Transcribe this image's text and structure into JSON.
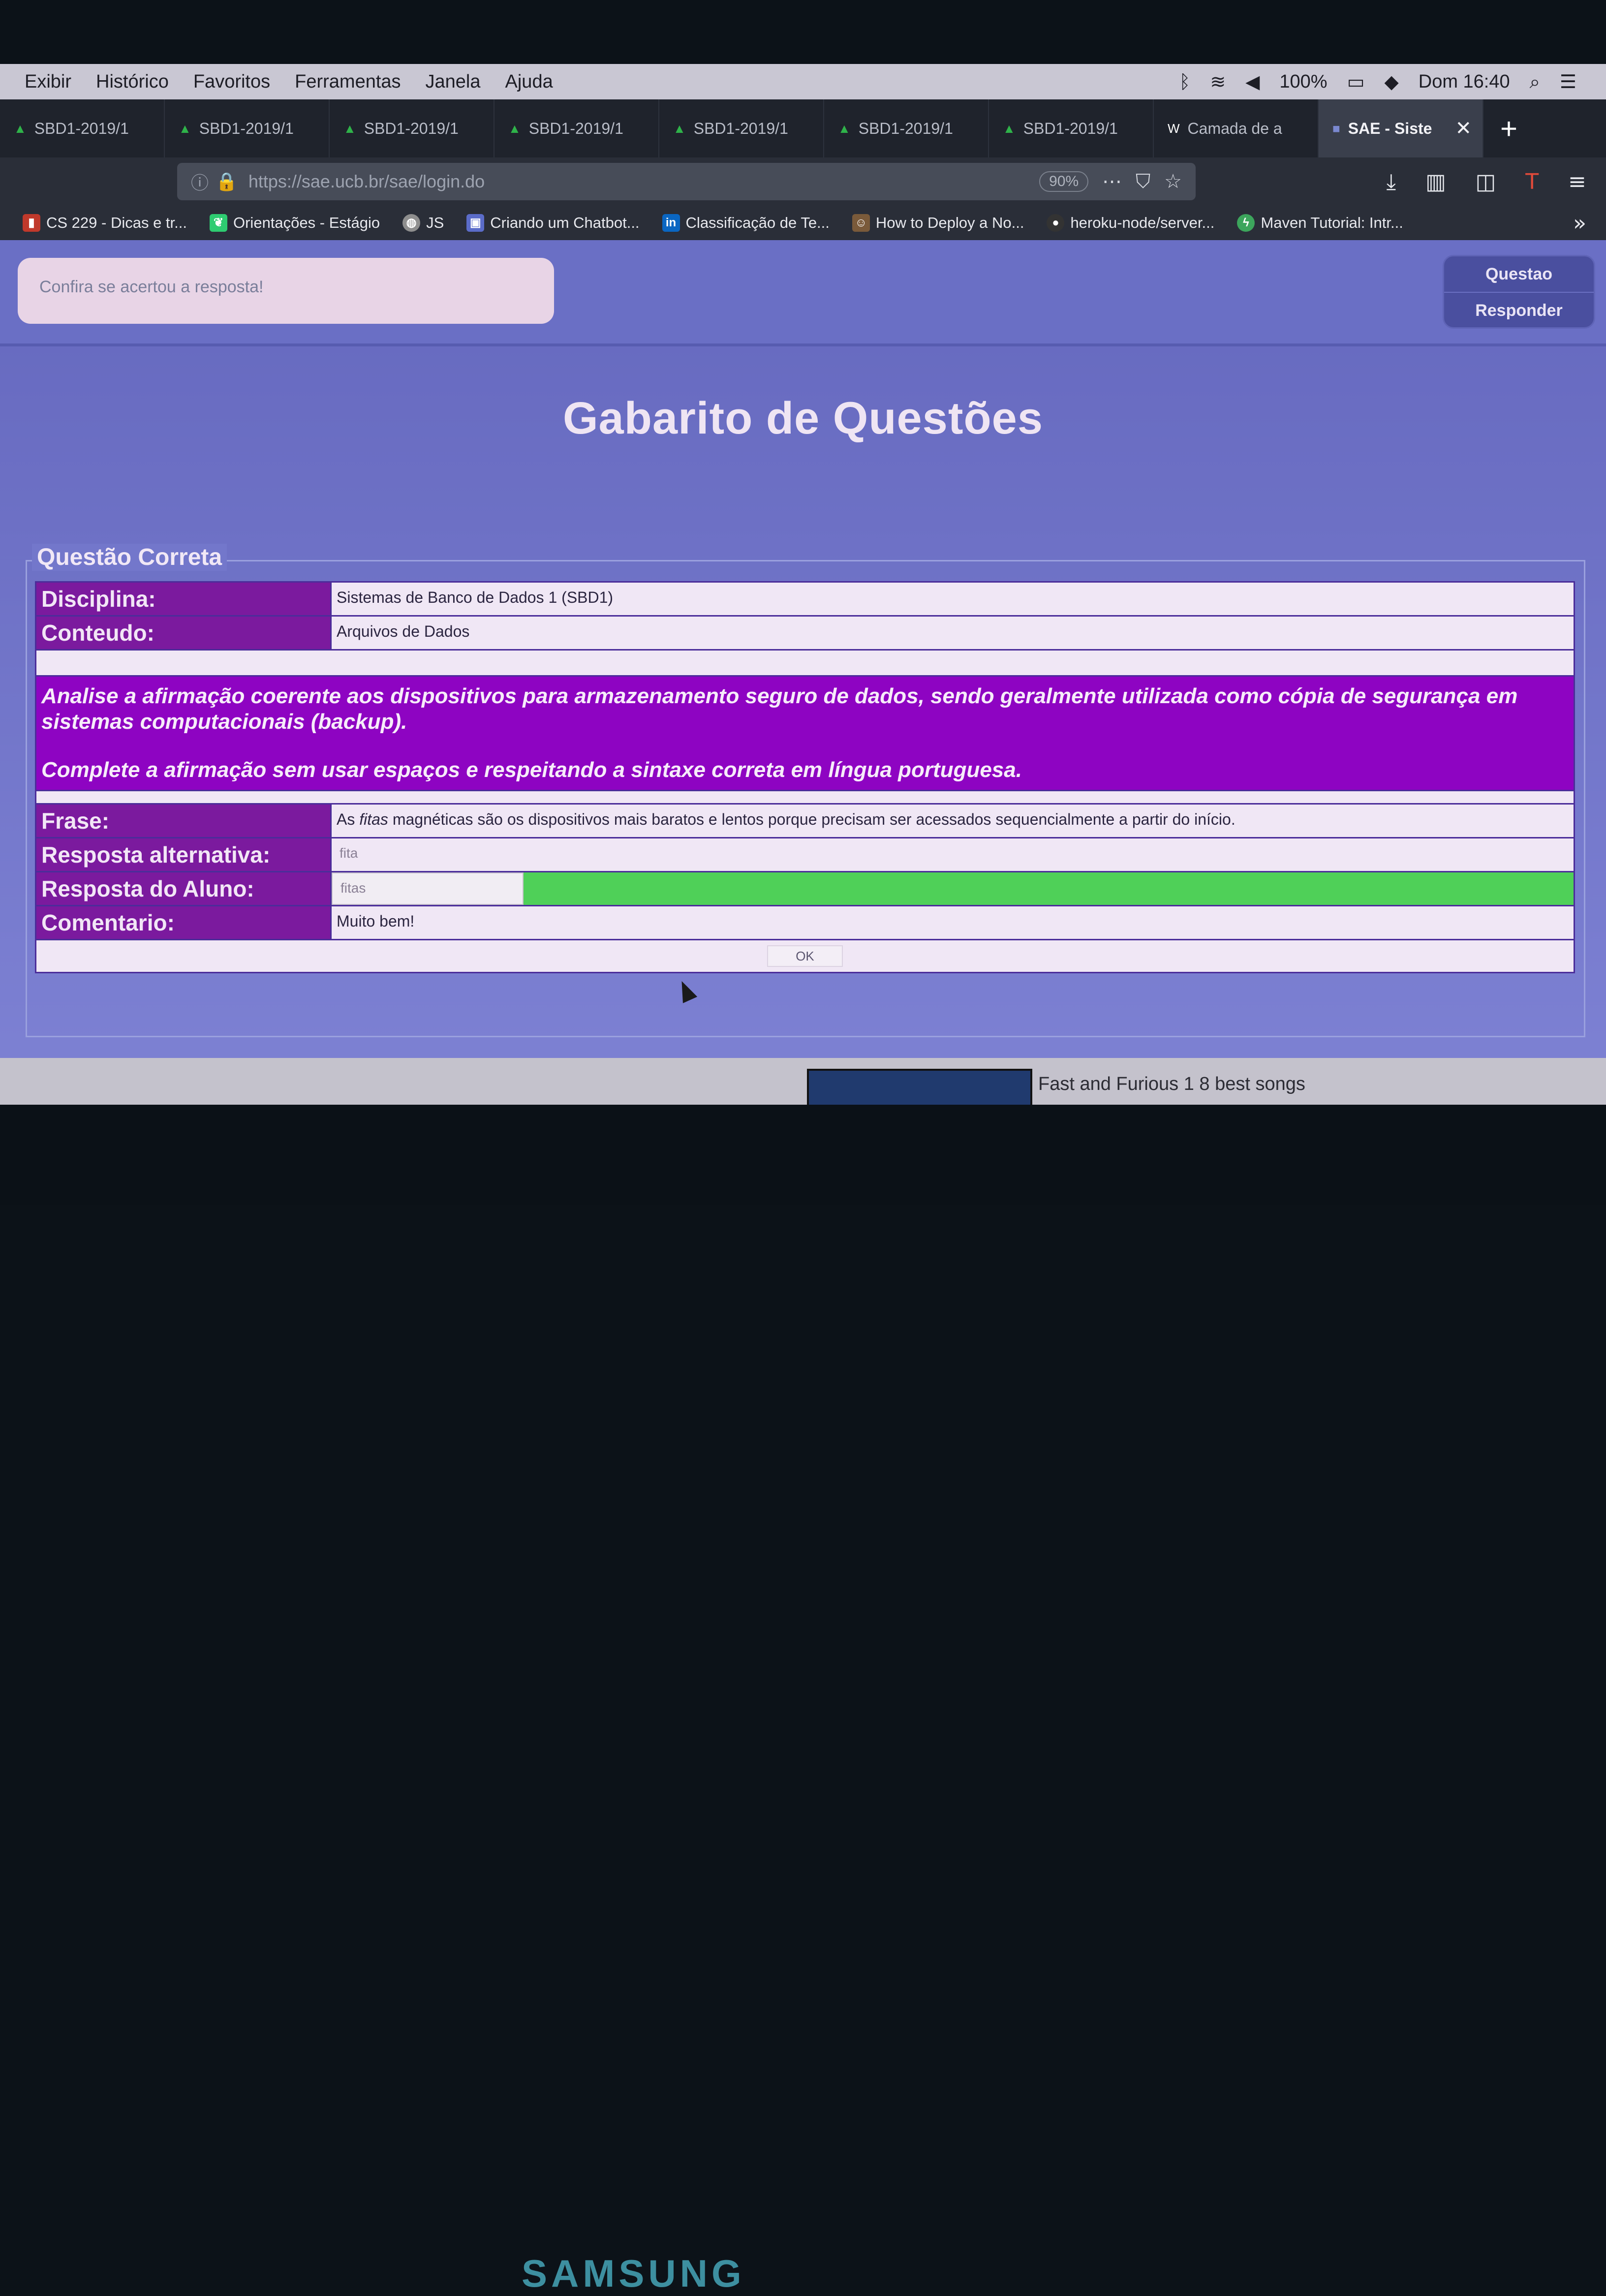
{
  "menubar": {
    "items": [
      "Exibir",
      "Histórico",
      "Favoritos",
      "Ferramentas",
      "Janela",
      "Ajuda"
    ],
    "battery": "100%",
    "clock": "Dom 16:40"
  },
  "tabs": [
    {
      "label": "SBD1-2019/1",
      "active": false
    },
    {
      "label": "SBD1-2019/1",
      "active": false
    },
    {
      "label": "SBD1-2019/1",
      "active": false
    },
    {
      "label": "SBD1-2019/1",
      "active": false
    },
    {
      "label": "SBD1-2019/1",
      "active": false
    },
    {
      "label": "SBD1-2019/1",
      "active": false
    },
    {
      "label": "SBD1-2019/1",
      "active": false
    },
    {
      "label": "Camada de a",
      "active": false
    },
    {
      "label": "SAE - Siste",
      "active": true
    }
  ],
  "navbar": {
    "url": "https://sae.ucb.br/sae/login.do",
    "zoom": "90%"
  },
  "bookmarks": [
    {
      "label": "CS 229 - Dicas e tr...",
      "icon": "bookmark-icon",
      "color": "#c0392b"
    },
    {
      "label": "Orientações - Estágio",
      "icon": "leaf-icon",
      "color": "#2ecc71"
    },
    {
      "label": "JS",
      "icon": "globe-icon",
      "color": "#8e8e8e"
    },
    {
      "label": "Criando um Chatbot...",
      "icon": "image-icon",
      "color": "#5b6cc9"
    },
    {
      "label": "Classificação de Te...",
      "icon": "linkedin-icon",
      "color": "#0a66c2"
    },
    {
      "label": "How to Deploy a No...",
      "icon": "person-icon",
      "color": "#7a5a3a"
    },
    {
      "label": "heroku-node/server...",
      "icon": "github-icon",
      "color": "#333333"
    },
    {
      "label": "Maven Tutorial: Intr...",
      "icon": "bolt-icon",
      "color": "#3ca55c"
    }
  ],
  "page": {
    "hint": "Confira se acertou a resposta!",
    "buttons": {
      "question": "Questao",
      "answer": "Responder"
    },
    "title": "Gabarito de Questões",
    "legend": "Questão Correta",
    "discipline_label": "Disciplina:",
    "discipline": "Sistemas de Banco de Dados 1 (SBD1)",
    "content_label": "Conteudo:",
    "content": "Arquivos de Dados",
    "question_line1": "Analise a afirmação coerente aos dispositivos para armazenamento seguro de dados, sendo geralmente utilizada como cópia de segurança em sistemas computacionais (backup).",
    "question_line2": "Complete a afirmação sem usar espaços e respeitando a sintaxe correta em língua portuguesa.",
    "phrase_label": "Frase:",
    "phrase_pre": "As ",
    "phrase_italic": "fitas",
    "phrase_post": " magnéticas são os dispositivos mais baratos e lentos porque precisam ser acessados sequencialmente a partir do início.",
    "alt_label": "Resposta alternativa:",
    "alt_answer": "fita",
    "student_label": "Resposta do Aluno:",
    "student_answer": "fitas",
    "comment_label": "Comentario:",
    "comment": "Muito bem!",
    "ok": "OK"
  },
  "colors": {
    "accent_purple": "#8e04c2",
    "label_purple": "#7b1a9e",
    "correct_green": "#4fd058",
    "background": "#6d72c4"
  },
  "desktop": {
    "video_title": "Fast and Furious 1 8 best songs",
    "monitor_brand": "SAMSUNG"
  }
}
